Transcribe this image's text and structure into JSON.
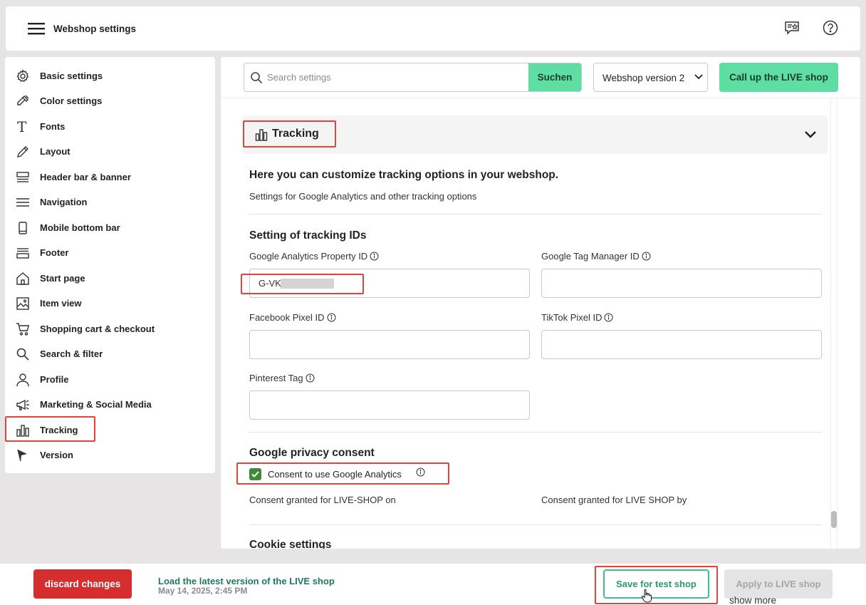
{
  "app": {
    "title": "Webshop settings"
  },
  "sidebar": {
    "items": [
      {
        "label": "Basic settings",
        "icon": "gear-icon"
      },
      {
        "label": "Color settings",
        "icon": "color-picker-icon"
      },
      {
        "label": "Fonts",
        "icon": "font-icon"
      },
      {
        "label": "Layout",
        "icon": "pencil-icon"
      },
      {
        "label": "Header bar & banner",
        "icon": "header-icon"
      },
      {
        "label": "Navigation",
        "icon": "menu-lines-icon"
      },
      {
        "label": "Mobile bottom bar",
        "icon": "mobile-icon"
      },
      {
        "label": "Footer",
        "icon": "footer-icon"
      },
      {
        "label": "Start page",
        "icon": "home-icon"
      },
      {
        "label": "Item view",
        "icon": "image-icon"
      },
      {
        "label": "Shopping cart & checkout",
        "icon": "cart-icon"
      },
      {
        "label": "Search & filter",
        "icon": "search-icon"
      },
      {
        "label": "Profile",
        "icon": "user-icon"
      },
      {
        "label": "Marketing & Social Media",
        "icon": "megaphone-icon"
      },
      {
        "label": "Tracking",
        "icon": "bar-chart-icon"
      },
      {
        "label": "Version",
        "icon": "flag-icon"
      }
    ]
  },
  "toolbar": {
    "search_placeholder": "Search settings",
    "search_button": "Suchen",
    "version_selected": "Webshop version 2",
    "live_button": "Call up the LIVE shop"
  },
  "tracking": {
    "section_title": "Tracking",
    "intro_heading": "Here you can customize tracking options in your webshop.",
    "intro_text": "Settings for Google Analytics and other tracking options",
    "ids_heading": "Setting of tracking IDs",
    "fields": {
      "ga_label": "Google Analytics Property ID",
      "ga_value": "G-VK",
      "gtm_label": "Google Tag Manager ID",
      "fb_label": "Facebook Pixel ID",
      "tiktok_label": "TikTok Pixel ID",
      "pinterest_label": "Pinterest Tag"
    },
    "privacy_heading": "Google privacy consent",
    "consent_label": "Consent to use Google Analytics",
    "consent_checked": true,
    "consent_on": "Consent granted for LIVE-SHOP on",
    "consent_by": "Consent granted for LIVE SHOP by",
    "cookie_heading": "Cookie settings"
  },
  "footer": {
    "discard": "discard changes",
    "load_latest": "Load the latest version of the LIVE shop",
    "load_date": "May 14, 2025, 2:45 PM",
    "save_test": "Save for test shop",
    "apply_live": "Apply to LIVE shop",
    "show_more": "show more"
  },
  "colors": {
    "accent_green": "#5fdea4",
    "danger_red": "#d62e2e",
    "highlight_red": "#e0443a",
    "checkbox_green": "#3e8a36"
  }
}
